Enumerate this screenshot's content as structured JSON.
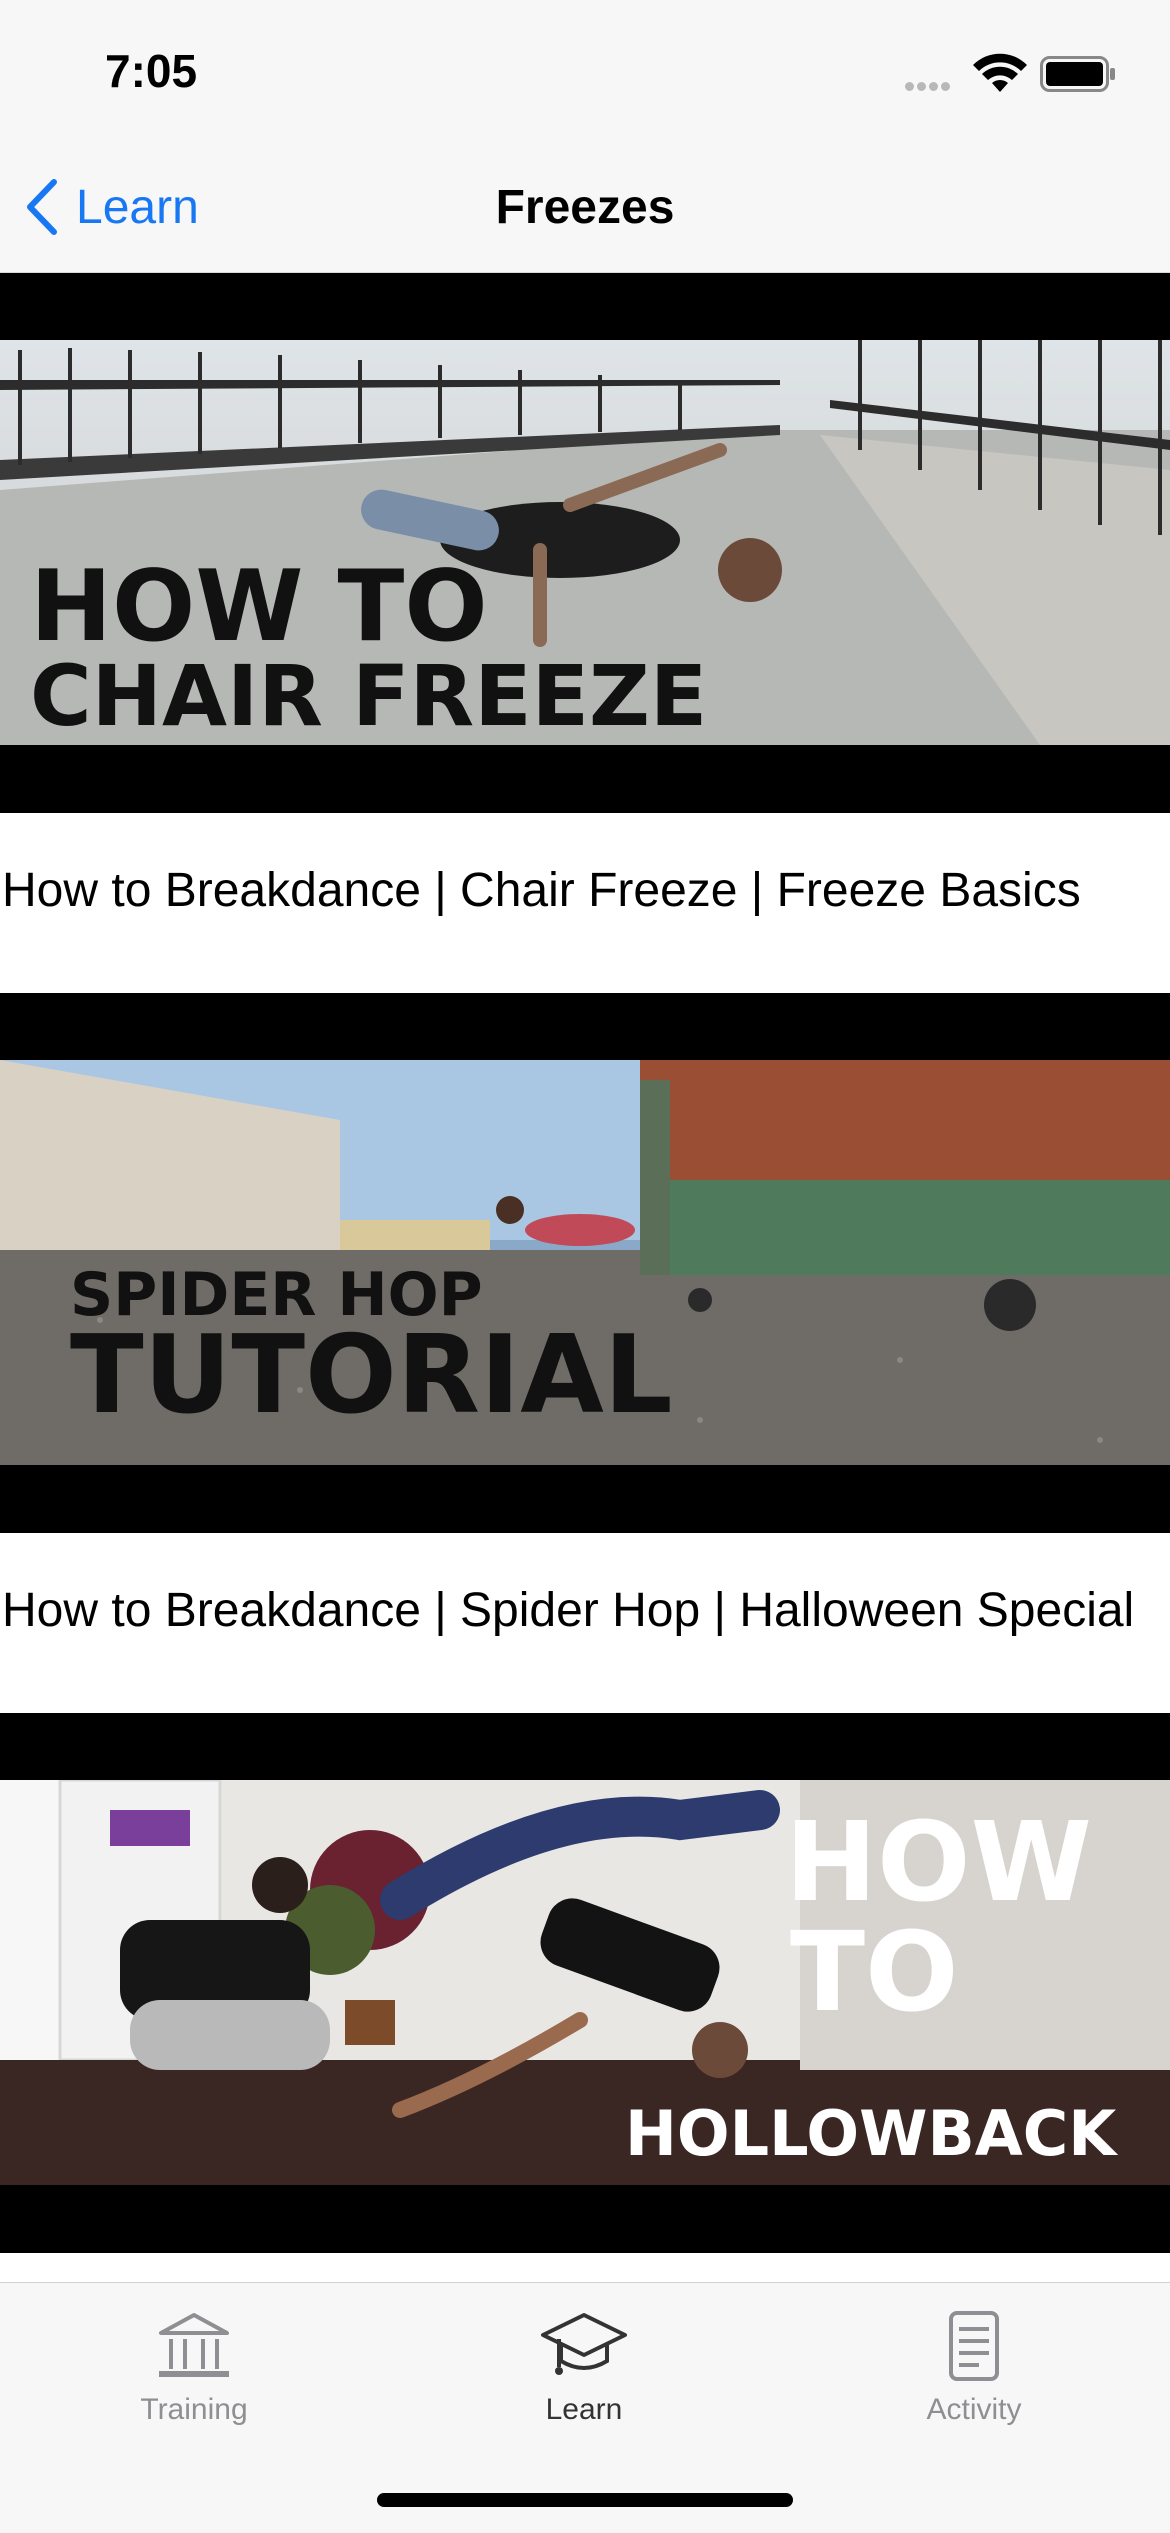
{
  "status_bar": {
    "time": "7:05"
  },
  "nav": {
    "back_label": "Learn",
    "title": "Freezes"
  },
  "videos": [
    {
      "title": "How to Breakdance | Chair Freeze | Freeze Basics",
      "overlay_line1": "HOW TO",
      "overlay_line2": "CHAIR FREEZE"
    },
    {
      "title": "How to Breakdance | Spider Hop | Halloween Special",
      "overlay_line1": "SPIDER HOP",
      "overlay_line2": "TUTORIAL"
    },
    {
      "title": "",
      "overlay_line1": "HOW",
      "overlay_line2": "TO",
      "overlay_line3": "HOLLOWBACK"
    }
  ],
  "tabs": [
    {
      "label": "Training",
      "icon": "bank-icon"
    },
    {
      "label": "Learn",
      "icon": "graduation-cap-icon"
    },
    {
      "label": "Activity",
      "icon": "document-icon"
    }
  ],
  "colors": {
    "accent": "#1877f2",
    "tab_inactive": "#8e8e93",
    "bar_bg": "#f7f7f7"
  }
}
